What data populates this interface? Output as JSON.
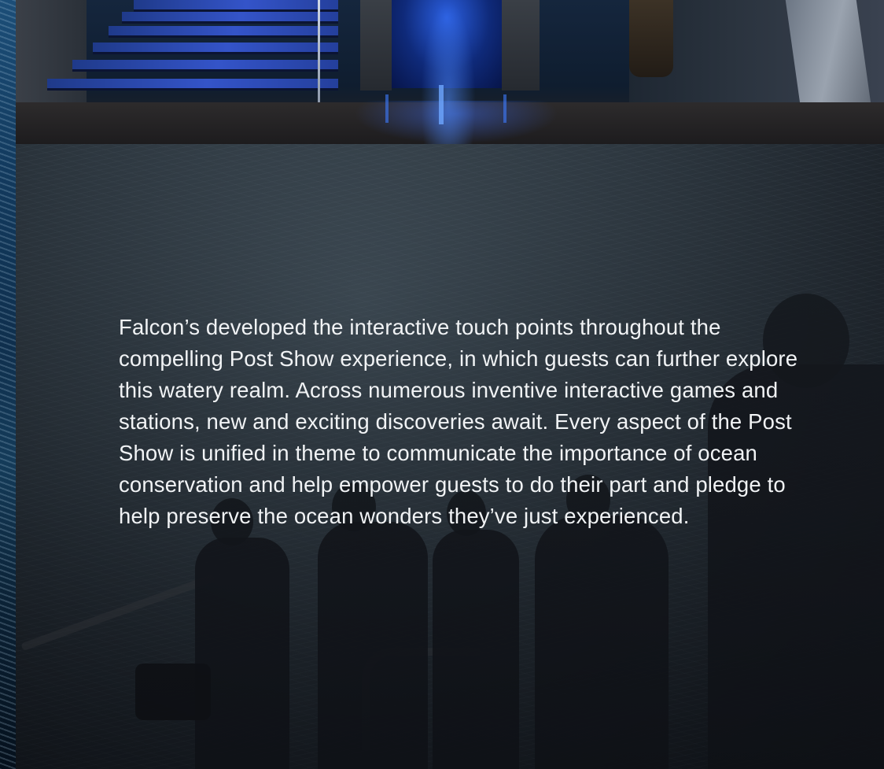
{
  "content": {
    "body_paragraph": "Falcon’s developed the interactive touch points throughout the compelling Post Show experience, in which guests can further explore this watery realm. Across numerous inventive interactive games and stations, new and exciting discoveries await. Every aspect of the Post Show is unified in theme to communicate the importance of ocean conservation and help empower guests to do their part and pledge to help preserve the ocean wonders they’ve just experienced."
  },
  "colors": {
    "text": "#f1f3f5",
    "accent_blue": "#3454c9",
    "background_dark": "#1c2229"
  }
}
